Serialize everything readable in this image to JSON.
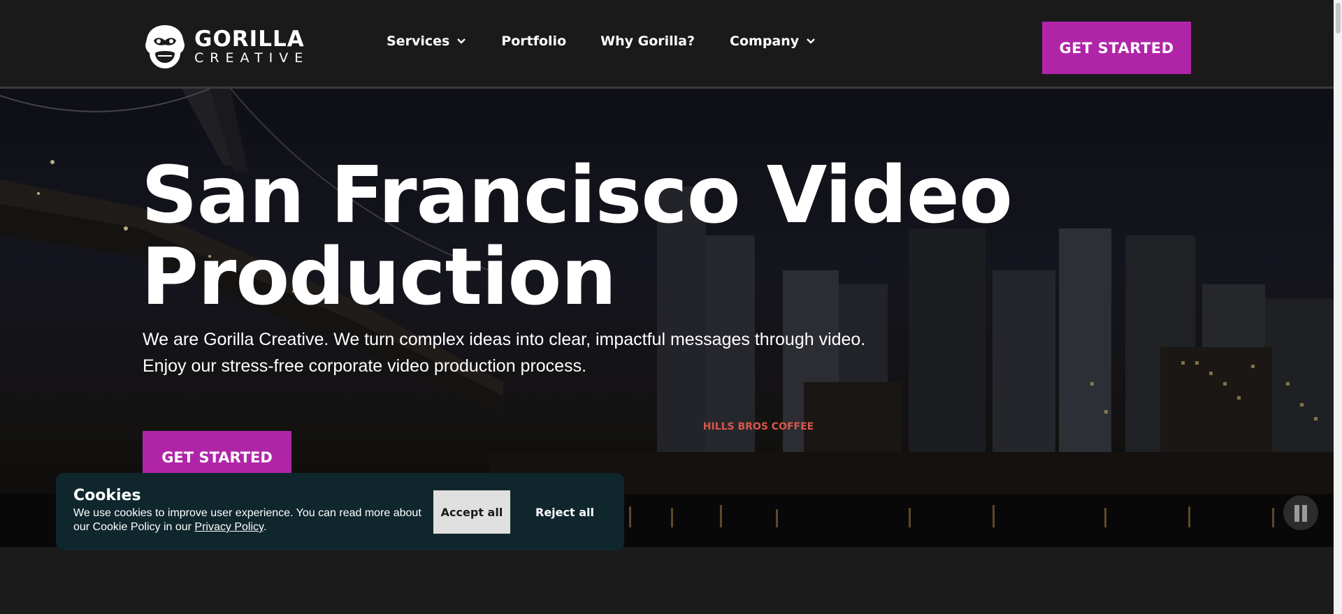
{
  "header": {
    "logo": {
      "line1": "GORILLA",
      "line2": "CREATIVE"
    },
    "nav": [
      {
        "label": "Services",
        "has_dropdown": true
      },
      {
        "label": "Portfolio",
        "has_dropdown": false
      },
      {
        "label": "Why Gorilla?",
        "has_dropdown": false
      },
      {
        "label": "Company",
        "has_dropdown": true
      }
    ],
    "cta_label": "GET STARTED"
  },
  "hero": {
    "title_line1": "San Francisco Video",
    "title_line2": "Production",
    "subtitle_line1": "We are Gorilla Creative. We turn complex ideas into clear, impactful messages through video.",
    "subtitle_line2": "Enjoy our stress-free corporate video production process.",
    "cta_label": "GET STARTED",
    "sign_text": "HILLS BROS COFFEE",
    "video_control": "pause-icon"
  },
  "cookie_banner": {
    "title": "Cookies",
    "text_before_link": "We use cookies to improve user experience. You can read more about our Cookie Policy in our ",
    "link_text": "Privacy Policy",
    "text_after_link": ".",
    "accept_label": "Accept all",
    "reject_label": "Reject all"
  },
  "colors": {
    "brand_purple": "#b025a8",
    "header_bg": "#1a1a1a",
    "cookie_bg": "#10262d",
    "page_bg": "#1b1b1b"
  }
}
